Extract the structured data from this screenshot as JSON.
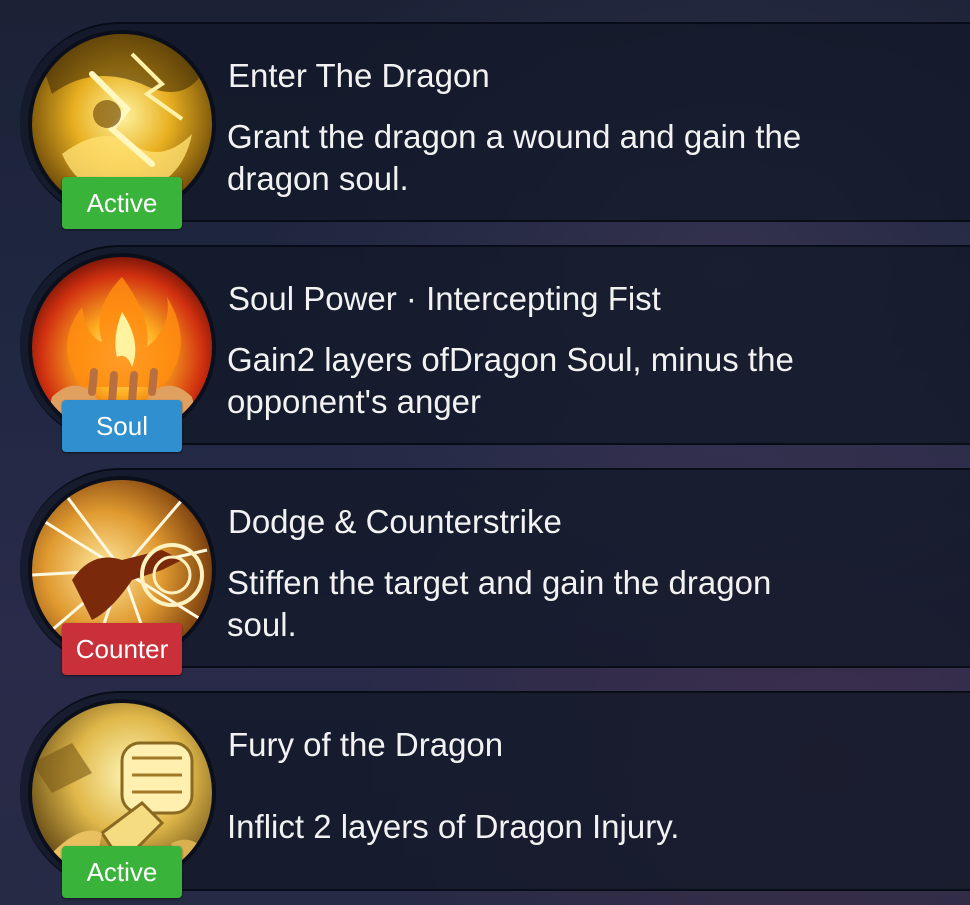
{
  "skills": [
    {
      "title": "Enter The Dragon",
      "description": "Grant the dragon a wound and gain the dragon soul.",
      "tag": "Active",
      "tag_color": "#39b33a",
      "icon": "golden-dragon-warrior-icon"
    },
    {
      "title": "Soul Power · Intercepting Fist",
      "description": "Gain2 layers ofDragon Soul, minus the opponent's anger",
      "tag": "Soul",
      "tag_color": "#2f8fcf",
      "icon": "flame-in-hand-icon"
    },
    {
      "title": "Dodge & Counterstrike",
      "description": "Stiffen the target and gain the dragon soul.",
      "tag": "Counter",
      "tag_color": "#c9303a",
      "icon": "shattering-strike-icon"
    },
    {
      "title": "Fury of the Dragon",
      "description": "Inflict 2 layers of Dragon Injury.",
      "tag": "Active",
      "tag_color": "#39b33a",
      "icon": "golden-fist-icon"
    }
  ]
}
